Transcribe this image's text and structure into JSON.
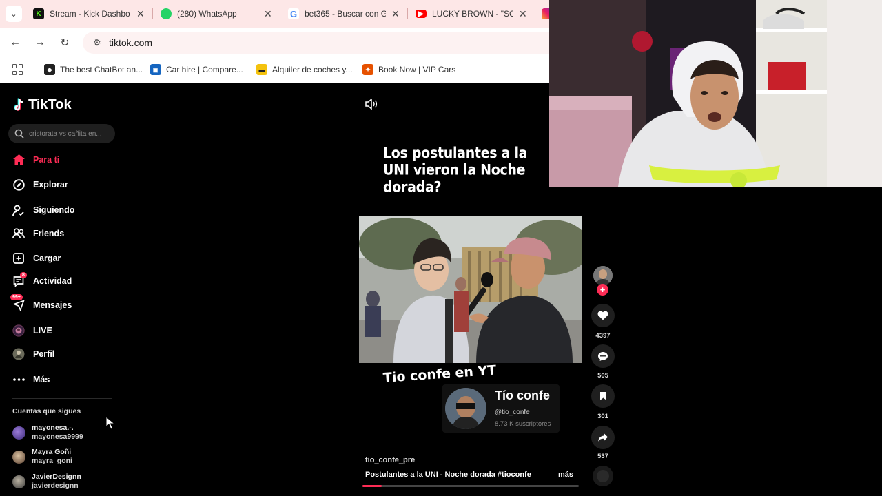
{
  "browser": {
    "tabs": [
      {
        "title": "Stream - Kick Dashbo",
        "icon": "kick-icon",
        "color": "#53fc18"
      },
      {
        "title": "(280) WhatsApp",
        "icon": "whatsapp-icon",
        "color": "#25d366"
      },
      {
        "title": "bet365 - Buscar con G",
        "icon": "google-icon",
        "color": "#4285f4"
      },
      {
        "title": "LUCKY BROWN - \"SC",
        "icon": "youtube-icon",
        "color": "#ff0000"
      }
    ],
    "address": "tiktok.com",
    "bookmarks": [
      {
        "label": "The best ChatBot an...",
        "icon": "chatbot-icon"
      },
      {
        "label": "Car hire | Compare...",
        "icon": "car-hire-icon"
      },
      {
        "label": "Alquiler de coches y...",
        "icon": "rental-icon"
      },
      {
        "label": "Book Now | VIP Cars",
        "icon": "vipcars-icon"
      }
    ]
  },
  "tiktok": {
    "logo": "TikTok",
    "search_placeholder": "cristorata vs cañita en...",
    "nav": [
      {
        "label": "Para ti",
        "icon": "home-icon"
      },
      {
        "label": "Explorar",
        "icon": "compass-icon"
      },
      {
        "label": "Siguiendo",
        "icon": "following-icon"
      },
      {
        "label": "Friends",
        "icon": "friends-icon"
      },
      {
        "label": "Cargar",
        "icon": "upload-icon"
      },
      {
        "label": "Actividad",
        "icon": "activity-icon",
        "badge": "8"
      },
      {
        "label": "Mensajes",
        "icon": "messages-icon",
        "badge": "99+"
      },
      {
        "label": "LIVE",
        "icon": "live-icon"
      },
      {
        "label": "Perfil",
        "icon": "profile-icon"
      },
      {
        "label": "Más",
        "icon": "more-icon"
      }
    ],
    "following_header": "Cuentas que sigues",
    "following": [
      {
        "name": "mayonesa.-.",
        "handle": "mayonesa9999"
      },
      {
        "name": "Mayra Goñi",
        "handle": "mayra_goni"
      },
      {
        "name": "JavierDesignn",
        "handle": "javierdesignn"
      }
    ]
  },
  "video": {
    "caption_top": "Los postulantes a la UNI vieron la Noche dorada?",
    "caption_mid": "Tio confe en YT",
    "yt_card": {
      "name": "Tío confe",
      "handle": "@tio_confe",
      "subs": "8.73 K suscriptores"
    },
    "author": "tio_confe_pre",
    "description": "Postulantes a la UNI - Noche dorada #tioconfe ...",
    "more": "más",
    "progress": 0.09,
    "likes": "4397",
    "comments": "505",
    "saves": "301",
    "shares": "537"
  }
}
